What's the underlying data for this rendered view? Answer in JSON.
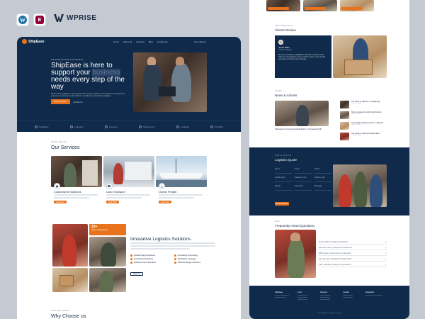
{
  "top_brand": {
    "wp_icon": "wordpress-icon",
    "el_icon": "elementor-icon",
    "brand_name": "WPRISE",
    "wp_glyph": "W",
    "el_glyph": "E"
  },
  "colors": {
    "navy": "#0f2a4a",
    "accent": "#e8731c",
    "background": "#c5cad2"
  },
  "left_page": {
    "nav": {
      "logo": "ShipEase",
      "items": [
        "Home",
        "About Us",
        "Services",
        "Blog",
        "Contact Us"
      ],
      "cta": "Get a Quote"
    },
    "hero": {
      "tag": "WE SHIP AROUND THE WORLD",
      "title_before": "ShipEase is here to support your ",
      "title_highlight": "business",
      "title_after": " needs every step of the way",
      "description": "Partner with ShipEase to stay ahead of the curve in logistics. Our solutions are designed to empower your business with efficient, cost-effective, and reliable shipping.",
      "button": "Discover More",
      "link": "Contact Us"
    },
    "partners": [
      "ShipEase",
      "Logistics",
      "Xpressa",
      "Transport X",
      "LuxEase",
      "ProShip"
    ],
    "services": {
      "tag": "WHAT WE DO",
      "title": "Our Services",
      "items": [
        {
          "title": "Customized Solutions",
          "button": "Learn More"
        },
        {
          "title": "Land Transport",
          "button": "Learn More"
        },
        {
          "title": "Ocean Freight",
          "button": "Learn More"
        }
      ]
    },
    "innovative": {
      "stat_number": "10+",
      "stat_label": "Years of Experience",
      "title": "Innovative Logistics Solutions",
      "checks": [
        "Global Freight Shipment",
        "Innovating Technology",
        "Customized Solutions",
        "Worldwide Coverage",
        "Quality Control Standard",
        "Efficient Supply Solutions"
      ],
      "button": "About Us"
    },
    "why": {
      "tag": "HOW WE WORK",
      "title": "Why Choose us"
    }
  },
  "right_page": {
    "reviews": {
      "tag": "TESTIMONIALS",
      "title": "Clients Review",
      "name": "Jonas Miller",
      "role": "Logistics Manager",
      "text": "We were impressed by ShipEase's attention to detail and the efficiency of its logistics services. Delivery was on time and the team kept us informed at every stage.",
      "nav": "‹ ›"
    },
    "news": {
      "tag": "NEWS",
      "title": "News & Articles",
      "feature_title": "Strategies for Improving Global Reach & Increasing Profit",
      "items": [
        {
          "title": "The future of logistics in a digital age",
          "date": "June 12, 2024"
        },
        {
          "title": "How to choose the right freight partner",
          "date": "June 12, 2024"
        },
        {
          "title": "Sustainable shipping practices explained",
          "date": "June 12, 2024"
        },
        {
          "title": "Top trends in warehouse automation",
          "date": "June 12, 2024"
        }
      ]
    },
    "quote": {
      "tag": "GET A QUOTE",
      "title": "Logistics Quote",
      "fields": [
        "Name",
        "Email",
        "Phone",
        "Freight Type",
        "Departure City",
        "Delivery City",
        "Weight",
        "Dimension",
        "Message"
      ],
      "button": "Submit Request"
    },
    "faq": {
      "tag": "FAQ",
      "title": "Frequently Asked Questions",
      "items": [
        "Do you offer international shipping?",
        "How do I track my shipment in real time?",
        "What types of goods can you transport?",
        "How are rates calculated for shipments?",
        "Can I schedule a pickup at my location?"
      ]
    },
    "footer": {
      "logo": "ShipEase",
      "columns": [
        "Links",
        "Services",
        "Contact",
        "Newsletter"
      ],
      "copyright": "© 2024 ShipEase. All rights reserved."
    }
  }
}
